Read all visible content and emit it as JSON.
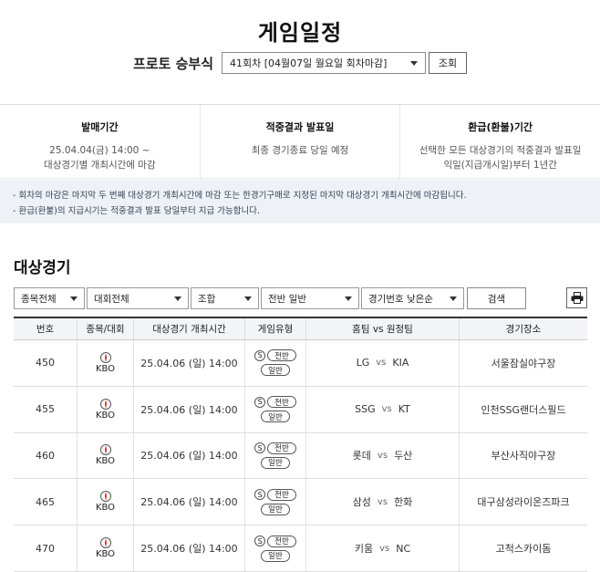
{
  "page_title": "게임일정",
  "round": {
    "label": "프로토 승부식",
    "selected": "41회차 [04월07일 월요일 회차마감]",
    "button": "조회"
  },
  "info": [
    {
      "head": "발매기간",
      "lines": [
        "25.04.04(금) 14:00 ~",
        "대상경기별 개최시간에 마감"
      ]
    },
    {
      "head": "적중결과 발표일",
      "lines": [
        "최종 경기종료 당일 예정"
      ]
    },
    {
      "head": "환급(환불)기간",
      "lines": [
        "선택한 모든 대상경기의 적중결과 발표일",
        "익일(지급개시일)부터 1년간"
      ]
    }
  ],
  "notes": [
    "- 회차의 마감은 마지막 두 번째 대상경기 개최시간에 마감 또는 한경기구매로 지정된 마지막 대상경기 개최시간에 마감됩니다.",
    "- 환급(환불)의 지급시기는 적중결과 발표 당일부터 지급 가능합니다."
  ],
  "section_title": "대상경기",
  "filters": {
    "sport": "종목전체",
    "league": "대회전체",
    "combo": "조합",
    "half": "전반 일반",
    "order": "경기번호 낮은순",
    "search": "검색",
    "print_icon": "printer-icon"
  },
  "table": {
    "headers": [
      "번호",
      "종목/대회",
      "대상경기 개최시간",
      "게임유형",
      "홈팀 vs 원정팀",
      "경기장소"
    ],
    "rows": [
      {
        "no": "450",
        "league": "KBO",
        "time": "25.04.06 (일) 14:00",
        "s": "S",
        "half": "전반",
        "type": "일반",
        "home": "LG",
        "vs": "vs",
        "away": "KIA",
        "venue": "서울잠실야구장"
      },
      {
        "no": "455",
        "league": "KBO",
        "time": "25.04.06 (일) 14:00",
        "s": "S",
        "half": "전반",
        "type": "일반",
        "home": "SSG",
        "vs": "vs",
        "away": "KT",
        "venue": "인천SSG랜더스필드"
      },
      {
        "no": "460",
        "league": "KBO",
        "time": "25.04.06 (일) 14:00",
        "s": "S",
        "half": "전반",
        "type": "일반",
        "home": "롯데",
        "vs": "vs",
        "away": "두산",
        "venue": "부산사직야구장"
      },
      {
        "no": "465",
        "league": "KBO",
        "time": "25.04.06 (일) 14:00",
        "s": "S",
        "half": "전반",
        "type": "일반",
        "home": "삼성",
        "vs": "vs",
        "away": "한화",
        "venue": "대구삼성라이온즈파크"
      },
      {
        "no": "470",
        "league": "KBO",
        "time": "25.04.06 (일) 14:00",
        "s": "S",
        "half": "전반",
        "type": "일반",
        "home": "키움",
        "vs": "vs",
        "away": "NC",
        "venue": "고척스카이돔"
      }
    ]
  }
}
